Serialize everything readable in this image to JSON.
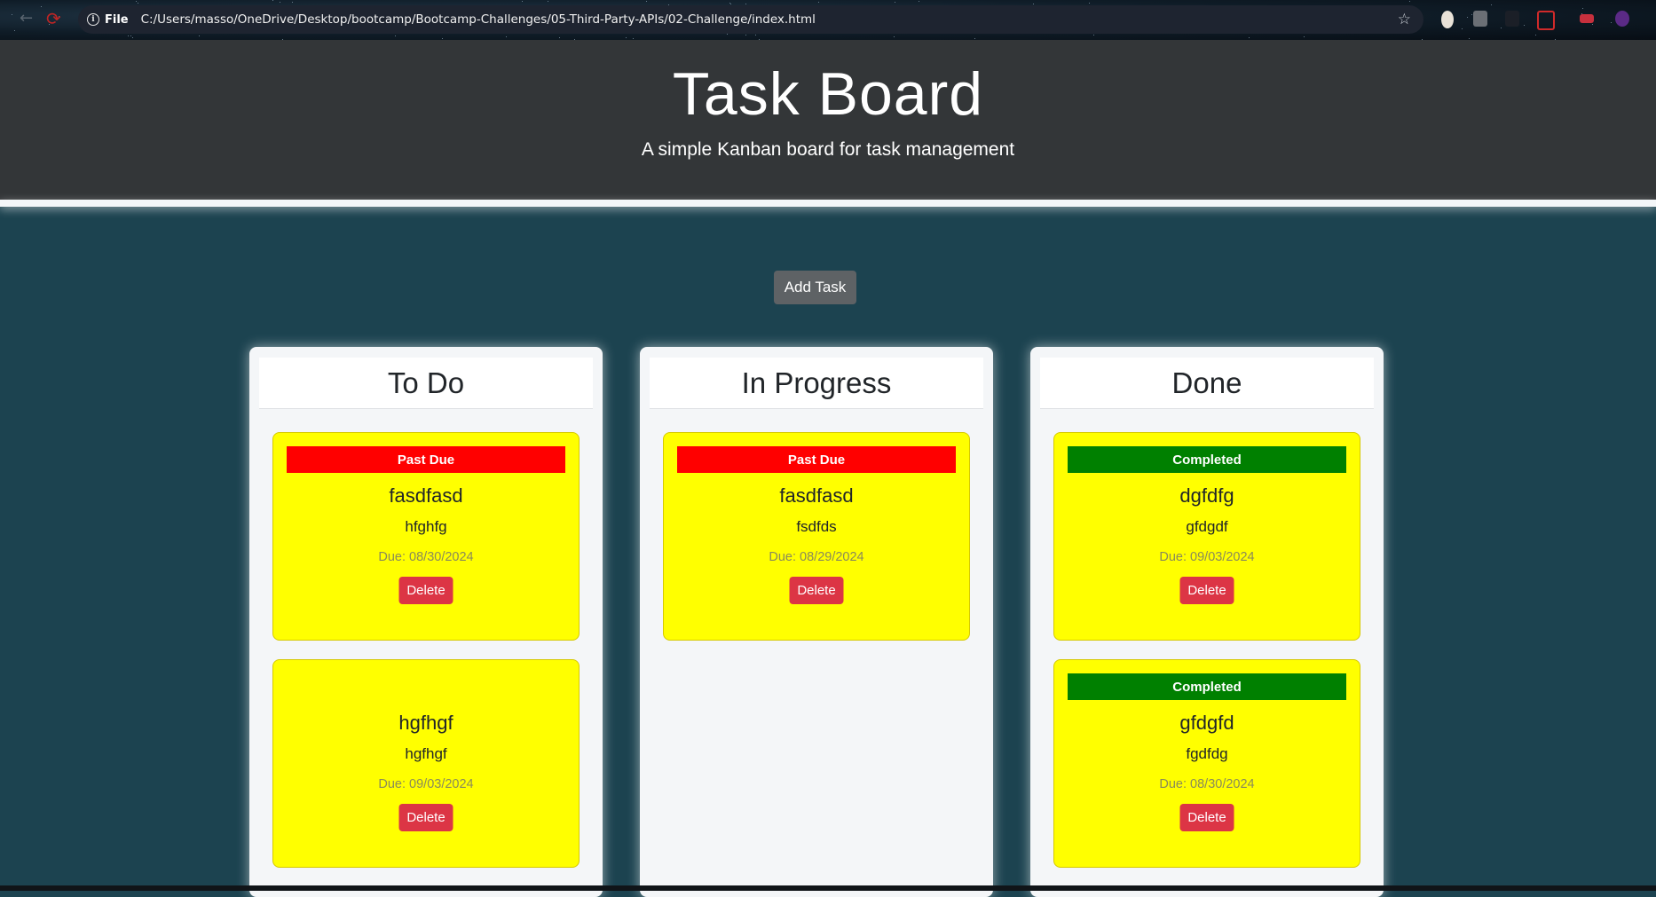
{
  "browser": {
    "file_label": "File",
    "url": "C:/Users/masso/OneDrive/Desktop/bootcamp/Bootcamp-Challenges/05-Third-Party-APIs/02-Challenge/index.html"
  },
  "header": {
    "title": "Task Board",
    "subtitle": "A simple Kanban board for task management"
  },
  "actions": {
    "add_task_label": "Add Task"
  },
  "lanes": [
    {
      "title": "To Do",
      "cards": [
        {
          "badge": "Past Due",
          "status": "past",
          "title": "fasdfasd",
          "description": "hfghfg",
          "due": "Due: 08/30/2024",
          "delete_label": "Delete"
        },
        {
          "badge": "",
          "status": "none",
          "title": "hgfhgf",
          "description": "hgfhgf",
          "due": "Due: 09/03/2024",
          "delete_label": "Delete"
        }
      ]
    },
    {
      "title": "In Progress",
      "cards": [
        {
          "badge": "Past Due",
          "status": "past",
          "title": "fasdfasd",
          "description": "fsdfds",
          "due": "Due: 08/29/2024",
          "delete_label": "Delete"
        }
      ]
    },
    {
      "title": "Done",
      "cards": [
        {
          "badge": "Completed",
          "status": "done",
          "title": "dgfdfg",
          "description": "gfdgdf",
          "due": "Due: 09/03/2024",
          "delete_label": "Delete"
        },
        {
          "badge": "Completed",
          "status": "done",
          "title": "gfdgfd",
          "description": "fgdfdg",
          "due": "Due: 08/30/2024",
          "delete_label": "Delete"
        }
      ]
    }
  ],
  "colors": {
    "page_bg": "#1c4350",
    "header_bg": "#333638",
    "card_bg": "#ffff00",
    "past_due": "#ff0000",
    "completed": "#008000",
    "delete": "#dc3545"
  }
}
